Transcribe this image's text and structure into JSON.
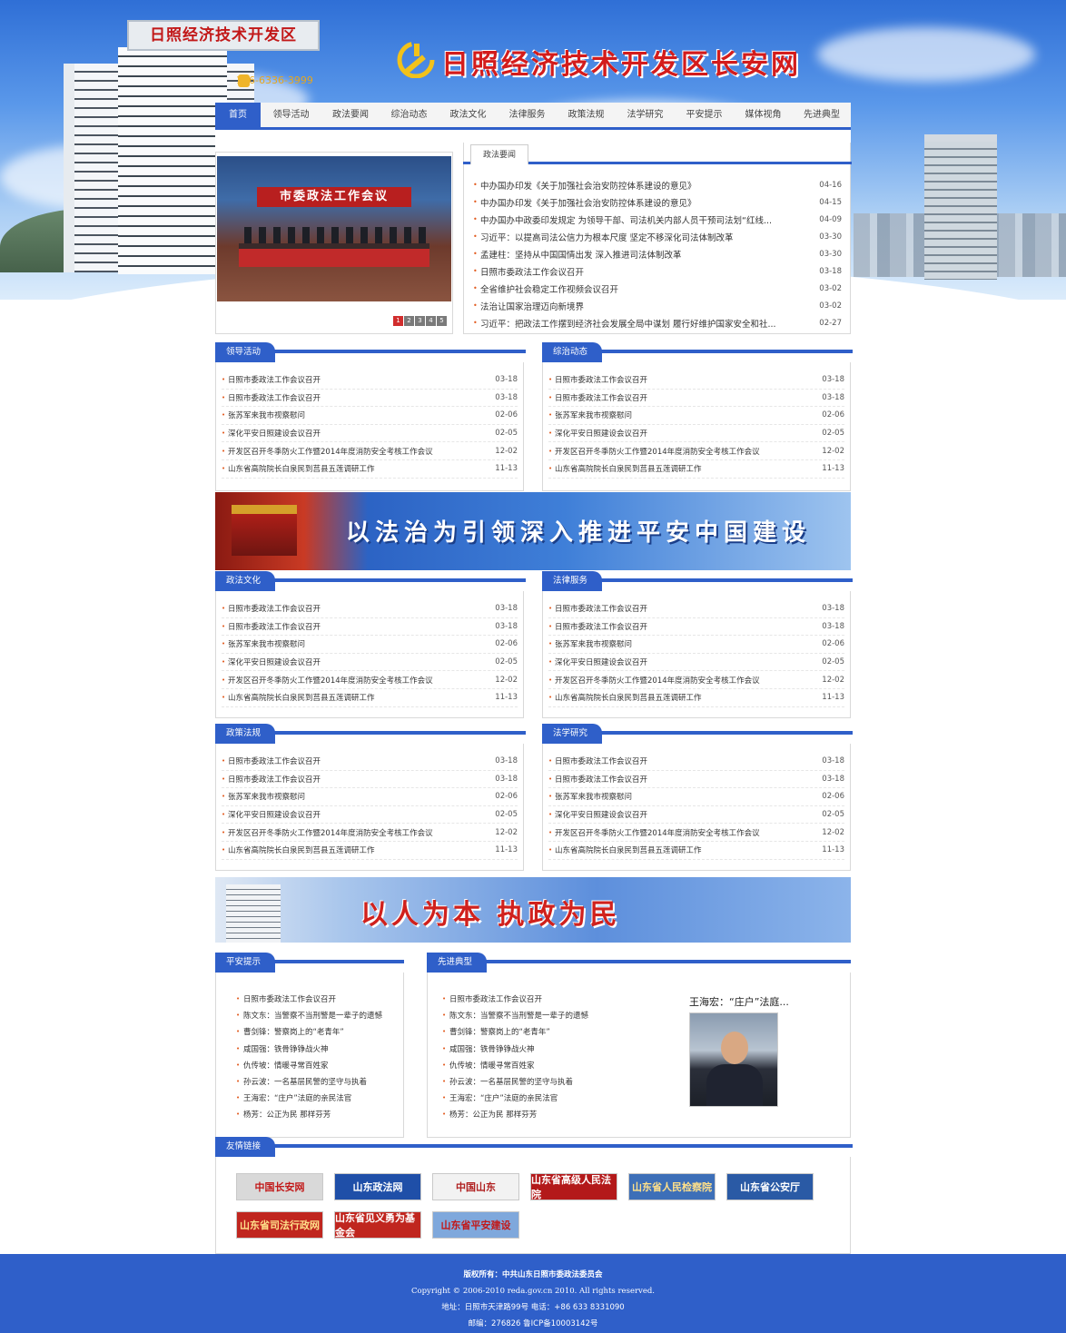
{
  "header": {
    "site_title": "日照经济技术开发区长安网",
    "building_sign": "日照经济技术开发区",
    "phone": "186-6336-3999"
  },
  "nav": {
    "items": [
      {
        "label": "首页",
        "active": true
      },
      {
        "label": "领导活动"
      },
      {
        "label": "政法要闻"
      },
      {
        "label": "综治动态"
      },
      {
        "label": "政法文化"
      },
      {
        "label": "法律服务"
      },
      {
        "label": "政策法规"
      },
      {
        "label": "法学研究"
      },
      {
        "label": "平安提示"
      },
      {
        "label": "媒体视角"
      },
      {
        "label": "先进典型"
      }
    ]
  },
  "slider": {
    "banner_text": "市委政法工作会议",
    "dots": [
      "1",
      "2",
      "3",
      "4",
      "5"
    ],
    "active_dot": 1
  },
  "news": {
    "tab": "政法要闻",
    "items": [
      {
        "title": "中办国办印发《关于加强社会治安防控体系建设的意见》",
        "date": "04-16"
      },
      {
        "title": "中办国办印发《关于加强社会治安防控体系建设的意见》",
        "date": "04-15"
      },
      {
        "title": "中办国办中政委印发规定 为领导干部、司法机关内部人员干预司法划“红线...",
        "date": "04-09"
      },
      {
        "title": "习近平：以提高司法公信力为根本尺度 坚定不移深化司法体制改革",
        "date": "03-30"
      },
      {
        "title": "孟建柱：坚持从中国国情出发 深入推进司法体制改革",
        "date": "03-30"
      },
      {
        "title": "日照市委政法工作会议召开",
        "date": "03-18"
      },
      {
        "title": "全省维护社会稳定工作视频会议召开",
        "date": "03-02"
      },
      {
        "title": "法治让国家治理迈向新境界",
        "date": "03-02"
      },
      {
        "title": "习近平：把政法工作摆到经济社会发展全局中谋划 履行好维护国家安全和社...",
        "date": "02-27"
      }
    ]
  },
  "sections": [
    {
      "title": "领导活动",
      "items": [
        {
          "title": "日照市委政法工作会议召开",
          "date": "03-18"
        },
        {
          "title": "日照市委政法工作会议召开",
          "date": "03-18"
        },
        {
          "title": "张苏军来我市视察慰问",
          "date": "02-06"
        },
        {
          "title": "深化平安日照建设会议召开",
          "date": "02-05"
        },
        {
          "title": "开发区召开冬季防火工作暨2014年度消防安全考核工作会议",
          "date": "12-02"
        },
        {
          "title": "山东省高院院长白泉民到莒县五莲调研工作",
          "date": "11-13"
        }
      ]
    },
    {
      "title": "综治动态",
      "items": [
        {
          "title": "日照市委政法工作会议召开",
          "date": "03-18"
        },
        {
          "title": "日照市委政法工作会议召开",
          "date": "03-18"
        },
        {
          "title": "张苏军来我市视察慰问",
          "date": "02-06"
        },
        {
          "title": "深化平安日照建设会议召开",
          "date": "02-05"
        },
        {
          "title": "开发区召开冬季防火工作暨2014年度消防安全考核工作会议",
          "date": "12-02"
        },
        {
          "title": "山东省高院院长白泉民到莒县五莲调研工作",
          "date": "11-13"
        }
      ]
    },
    {
      "title": "政法文化",
      "items": [
        {
          "title": "日照市委政法工作会议召开",
          "date": "03-18"
        },
        {
          "title": "日照市委政法工作会议召开",
          "date": "03-18"
        },
        {
          "title": "张苏军来我市视察慰问",
          "date": "02-06"
        },
        {
          "title": "深化平安日照建设会议召开",
          "date": "02-05"
        },
        {
          "title": "开发区召开冬季防火工作暨2014年度消防安全考核工作会议",
          "date": "12-02"
        },
        {
          "title": "山东省高院院长白泉民到莒县五莲调研工作",
          "date": "11-13"
        }
      ]
    },
    {
      "title": "法律服务",
      "items": [
        {
          "title": "日照市委政法工作会议召开",
          "date": "03-18"
        },
        {
          "title": "日照市委政法工作会议召开",
          "date": "03-18"
        },
        {
          "title": "张苏军来我市视察慰问",
          "date": "02-06"
        },
        {
          "title": "深化平安日照建设会议召开",
          "date": "02-05"
        },
        {
          "title": "开发区召开冬季防火工作暨2014年度消防安全考核工作会议",
          "date": "12-02"
        },
        {
          "title": "山东省高院院长白泉民到莒县五莲调研工作",
          "date": "11-13"
        }
      ]
    },
    {
      "title": "政策法规",
      "items": [
        {
          "title": "日照市委政法工作会议召开",
          "date": "03-18"
        },
        {
          "title": "日照市委政法工作会议召开",
          "date": "03-18"
        },
        {
          "title": "张苏军来我市视察慰问",
          "date": "02-06"
        },
        {
          "title": "深化平安日照建设会议召开",
          "date": "02-05"
        },
        {
          "title": "开发区召开冬季防火工作暨2014年度消防安全考核工作会议",
          "date": "12-02"
        },
        {
          "title": "山东省高院院长白泉民到莒县五莲调研工作",
          "date": "11-13"
        }
      ]
    },
    {
      "title": "法学研究",
      "items": [
        {
          "title": "日照市委政法工作会议召开",
          "date": "03-18"
        },
        {
          "title": "日照市委政法工作会议召开",
          "date": "03-18"
        },
        {
          "title": "张苏军来我市视察慰问",
          "date": "02-06"
        },
        {
          "title": "深化平安日照建设会议召开",
          "date": "02-05"
        },
        {
          "title": "开发区召开冬季防火工作暨2014年度消防安全考核工作会议",
          "date": "12-02"
        },
        {
          "title": "山东省高院院长白泉民到莒县五莲调研工作",
          "date": "11-13"
        }
      ]
    }
  ],
  "banners": {
    "banner1_text": "以法治为引领深入推进平安中国建设",
    "banner2_text": "以人为本 执政为民"
  },
  "safety": {
    "title": "平安提示",
    "items": [
      "日照市委政法工作会议召开",
      "陈文东：当警察不当刑警是一辈子的遗憾",
      "曹剑锋：警察岗上的“老青年”",
      "咸国强：铁骨铮铮战火神",
      "仇传坡：情暖寻常百姓家",
      "孙云波：一名基层民警的坚守与执着",
      "王海宏：“庄户”法庭的亲民法官",
      "杨芳：公正为民 那样芬芳"
    ]
  },
  "advanced": {
    "title": "先进典型",
    "items": [
      "日照市委政法工作会议召开",
      "陈文东：当警察不当刑警是一辈子的遗憾",
      "曹剑锋：警察岗上的“老青年”",
      "咸国强：铁骨铮铮战火神",
      "仇传坡：情暖寻常百姓家",
      "孙云波：一名基层民警的坚守与执着",
      "王海宏：“庄户”法庭的亲民法官",
      "杨芳：公正为民 那样芬芳"
    ],
    "featured_title": "王海宏：“庄户”法庭..."
  },
  "links": {
    "title": "友情链接",
    "items": [
      {
        "label": "中国长安网",
        "color": "#d9d9d9",
        "text_color": "#c21818"
      },
      {
        "label": "山东政法网",
        "color": "#1f4fa8",
        "text_color": "#ffffff"
      },
      {
        "label": "中国山东",
        "color": "#f2f2f2",
        "text_color": "#b02020"
      },
      {
        "label": "山东省高级人民法院",
        "color": "#b3191a",
        "text_color": "#ffffff"
      },
      {
        "label": "山东省人民检察院",
        "color": "#3d6fb8",
        "text_color": "#ffe08a"
      },
      {
        "label": "山东省公安厅",
        "color": "#2a5aa5",
        "text_color": "#ffffff"
      },
      {
        "label": "山东省司法行政网",
        "color": "#c0261f",
        "text_color": "#ffe08a"
      },
      {
        "label": "山东省见义勇为基金会",
        "color": "#c0261f",
        "text_color": "#ffffff"
      },
      {
        "label": "山东省平安建设",
        "color": "#7fa8dc",
        "text_color": "#c21818"
      }
    ]
  },
  "footer": {
    "line1": "版权所有：中共山东日照市委政法委员会",
    "line2": "Copyright © 2006-2010 reda.gov.cn 2010. All rights reserved.",
    "line3": "地址：日照市天津路99号 电话：+86 633 8331090",
    "line4": "邮编：276826 鲁ICP备10003142号"
  },
  "colors": {
    "primary": "#2f5fc9",
    "accent_red": "#d31c1c",
    "bullet": "#e25b1f"
  }
}
